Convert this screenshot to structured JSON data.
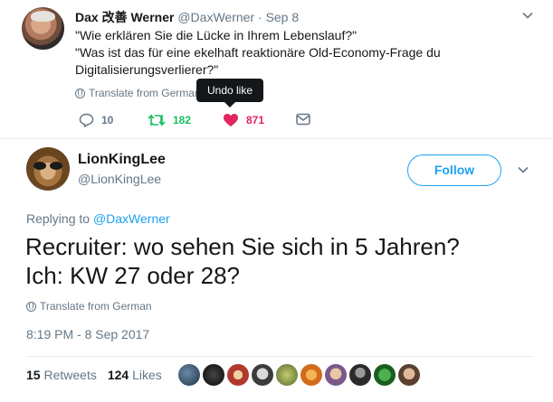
{
  "parent_tweet": {
    "name": "Dax 改善 Werner",
    "handle": "@DaxWerner",
    "separator": "·",
    "date": "Sep 8",
    "lines": [
      "\"Wie erklären Sie die Lücke in Ihrem Lebenslauf?\"",
      "\"Was ist das für eine ekelhaft reaktionäre Old-Economy-Frage du",
      "Digitalisierungsverlierer?\""
    ],
    "translate_label": "Translate from German",
    "tooltip": "Undo like",
    "reply_count": "10",
    "retweet_count": "182",
    "like_count": "871",
    "colors": {
      "retweet": "#17bf63",
      "like": "#e0245e"
    }
  },
  "main_tweet": {
    "name": "LionKingLee",
    "handle": "@LionKingLee",
    "follow_label": "Follow",
    "replying_prefix": "Replying to",
    "replying_to": "@DaxWerner",
    "lines": [
      "Recruiter: wo sehen Sie sich in 5 Jahren?",
      "Ich: KW 27 oder 28?"
    ],
    "translate_label": "Translate from German",
    "timestamp": "8:19 PM - 8 Sep 2017",
    "retweets_count": "15",
    "retweets_label": "Retweets",
    "likes_count": "124",
    "likes_label": "Likes",
    "accent": "#1da1f2"
  },
  "icons": [
    "reply-icon",
    "retweet-icon",
    "heart-icon",
    "direct-message-icon",
    "globe-icon",
    "chevron-down-icon"
  ]
}
